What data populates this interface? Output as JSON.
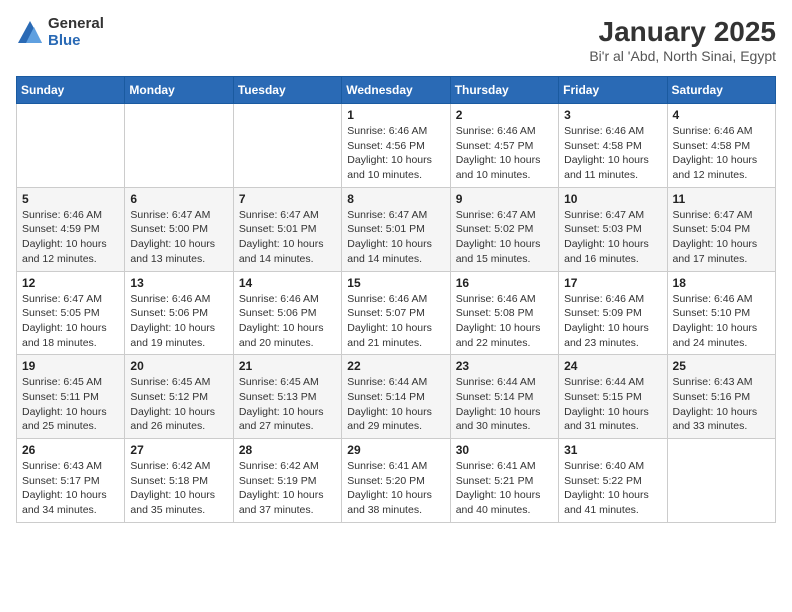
{
  "logo": {
    "general": "General",
    "blue": "Blue"
  },
  "title": "January 2025",
  "subtitle": "Bi'r al 'Abd, North Sinai, Egypt",
  "days_of_week": [
    "Sunday",
    "Monday",
    "Tuesday",
    "Wednesday",
    "Thursday",
    "Friday",
    "Saturday"
  ],
  "weeks": [
    [
      {
        "day": "",
        "info": ""
      },
      {
        "day": "",
        "info": ""
      },
      {
        "day": "",
        "info": ""
      },
      {
        "day": "1",
        "info": "Sunrise: 6:46 AM\nSunset: 4:56 PM\nDaylight: 10 hours\nand 10 minutes."
      },
      {
        "day": "2",
        "info": "Sunrise: 6:46 AM\nSunset: 4:57 PM\nDaylight: 10 hours\nand 10 minutes."
      },
      {
        "day": "3",
        "info": "Sunrise: 6:46 AM\nSunset: 4:58 PM\nDaylight: 10 hours\nand 11 minutes."
      },
      {
        "day": "4",
        "info": "Sunrise: 6:46 AM\nSunset: 4:58 PM\nDaylight: 10 hours\nand 12 minutes."
      }
    ],
    [
      {
        "day": "5",
        "info": "Sunrise: 6:46 AM\nSunset: 4:59 PM\nDaylight: 10 hours\nand 12 minutes."
      },
      {
        "day": "6",
        "info": "Sunrise: 6:47 AM\nSunset: 5:00 PM\nDaylight: 10 hours\nand 13 minutes."
      },
      {
        "day": "7",
        "info": "Sunrise: 6:47 AM\nSunset: 5:01 PM\nDaylight: 10 hours\nand 14 minutes."
      },
      {
        "day": "8",
        "info": "Sunrise: 6:47 AM\nSunset: 5:01 PM\nDaylight: 10 hours\nand 14 minutes."
      },
      {
        "day": "9",
        "info": "Sunrise: 6:47 AM\nSunset: 5:02 PM\nDaylight: 10 hours\nand 15 minutes."
      },
      {
        "day": "10",
        "info": "Sunrise: 6:47 AM\nSunset: 5:03 PM\nDaylight: 10 hours\nand 16 minutes."
      },
      {
        "day": "11",
        "info": "Sunrise: 6:47 AM\nSunset: 5:04 PM\nDaylight: 10 hours\nand 17 minutes."
      }
    ],
    [
      {
        "day": "12",
        "info": "Sunrise: 6:47 AM\nSunset: 5:05 PM\nDaylight: 10 hours\nand 18 minutes."
      },
      {
        "day": "13",
        "info": "Sunrise: 6:46 AM\nSunset: 5:06 PM\nDaylight: 10 hours\nand 19 minutes."
      },
      {
        "day": "14",
        "info": "Sunrise: 6:46 AM\nSunset: 5:06 PM\nDaylight: 10 hours\nand 20 minutes."
      },
      {
        "day": "15",
        "info": "Sunrise: 6:46 AM\nSunset: 5:07 PM\nDaylight: 10 hours\nand 21 minutes."
      },
      {
        "day": "16",
        "info": "Sunrise: 6:46 AM\nSunset: 5:08 PM\nDaylight: 10 hours\nand 22 minutes."
      },
      {
        "day": "17",
        "info": "Sunrise: 6:46 AM\nSunset: 5:09 PM\nDaylight: 10 hours\nand 23 minutes."
      },
      {
        "day": "18",
        "info": "Sunrise: 6:46 AM\nSunset: 5:10 PM\nDaylight: 10 hours\nand 24 minutes."
      }
    ],
    [
      {
        "day": "19",
        "info": "Sunrise: 6:45 AM\nSunset: 5:11 PM\nDaylight: 10 hours\nand 25 minutes."
      },
      {
        "day": "20",
        "info": "Sunrise: 6:45 AM\nSunset: 5:12 PM\nDaylight: 10 hours\nand 26 minutes."
      },
      {
        "day": "21",
        "info": "Sunrise: 6:45 AM\nSunset: 5:13 PM\nDaylight: 10 hours\nand 27 minutes."
      },
      {
        "day": "22",
        "info": "Sunrise: 6:44 AM\nSunset: 5:14 PM\nDaylight: 10 hours\nand 29 minutes."
      },
      {
        "day": "23",
        "info": "Sunrise: 6:44 AM\nSunset: 5:14 PM\nDaylight: 10 hours\nand 30 minutes."
      },
      {
        "day": "24",
        "info": "Sunrise: 6:44 AM\nSunset: 5:15 PM\nDaylight: 10 hours\nand 31 minutes."
      },
      {
        "day": "25",
        "info": "Sunrise: 6:43 AM\nSunset: 5:16 PM\nDaylight: 10 hours\nand 33 minutes."
      }
    ],
    [
      {
        "day": "26",
        "info": "Sunrise: 6:43 AM\nSunset: 5:17 PM\nDaylight: 10 hours\nand 34 minutes."
      },
      {
        "day": "27",
        "info": "Sunrise: 6:42 AM\nSunset: 5:18 PM\nDaylight: 10 hours\nand 35 minutes."
      },
      {
        "day": "28",
        "info": "Sunrise: 6:42 AM\nSunset: 5:19 PM\nDaylight: 10 hours\nand 37 minutes."
      },
      {
        "day": "29",
        "info": "Sunrise: 6:41 AM\nSunset: 5:20 PM\nDaylight: 10 hours\nand 38 minutes."
      },
      {
        "day": "30",
        "info": "Sunrise: 6:41 AM\nSunset: 5:21 PM\nDaylight: 10 hours\nand 40 minutes."
      },
      {
        "day": "31",
        "info": "Sunrise: 6:40 AM\nSunset: 5:22 PM\nDaylight: 10 hours\nand 41 minutes."
      },
      {
        "day": "",
        "info": ""
      }
    ]
  ]
}
